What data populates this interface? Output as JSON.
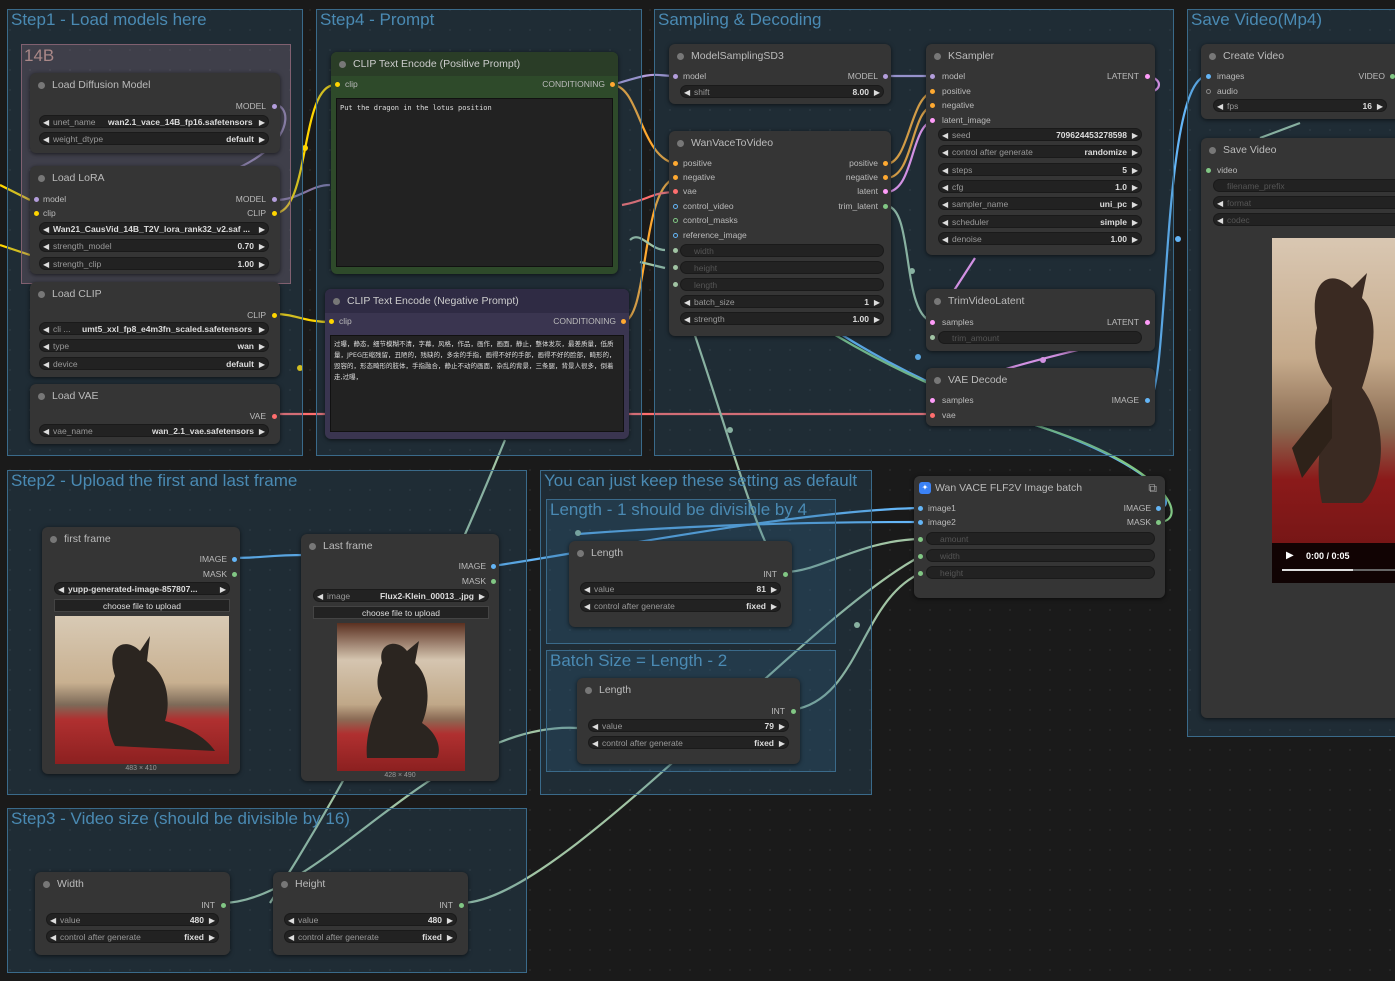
{
  "groups": {
    "step1": "Step1 - Load models here",
    "step4": "Step4 - Prompt",
    "sampling": "Sampling & Decoding",
    "save": "Save Video(Mp4)",
    "step2": "Step2 - Upload the first and last frame",
    "defaults": "You can just keep these setting as default",
    "length_div": "Length - 1 should be divisible by 4",
    "batch": "Batch Size = Length - 2",
    "step3": "Step3 - Video size (should be divisible by 16)",
    "sub14b": "14B"
  },
  "load_diffusion": {
    "title": "Load Diffusion Model",
    "out": "MODEL",
    "unet_label": "unet_name",
    "unet_value": "wan2.1_vace_14B_fp16.safetensors",
    "dtype_label": "weight_dtype",
    "dtype_value": "default"
  },
  "load_lora": {
    "title": "Load LoRA",
    "in_model": "model",
    "in_clip": "clip",
    "out_model": "MODEL",
    "out_clip": "CLIP",
    "lora_name": "Wan21_CausVid_14B_T2V_lora_rank32_v2.saf ...",
    "strength_model_label": "strength_model",
    "strength_model_value": "0.70",
    "strength_clip_label": "strength_clip",
    "strength_clip_value": "1.00"
  },
  "load_clip": {
    "title": "Load CLIP",
    "out": "CLIP",
    "name_label": "cli ...",
    "name_value": "umt5_xxl_fp8_e4m3fn_scaled.safetensors",
    "type_label": "type",
    "type_value": "wan",
    "device_label": "device",
    "device_value": "default"
  },
  "load_vae": {
    "title": "Load VAE",
    "out": "VAE",
    "name_label": "vae_name",
    "name_value": "wan_2.1_vae.safetensors"
  },
  "pos_prompt": {
    "title": "CLIP Text Encode (Positive Prompt)",
    "in": "clip",
    "out": "CONDITIONING",
    "text": "Put the dragon in the lotus position"
  },
  "neg_prompt": {
    "title": "CLIP Text Encode (Negative Prompt)",
    "in": "clip",
    "out": "CONDITIONING",
    "text": "过曝，静态，细节模糊不清，字幕，风格，作品，画作，画面，静止，整体发灰，最差质量，低质量，JPEG压缩残留，丑陋的，残缺的，多余的手指，画得不好的手部，画得不好的脸部，畸形的，毁容的，形态畸形的肢体，手指融合，静止不动的画面，杂乱的背景，三条腿，背景人很多，倒着走,过曝，"
  },
  "model_sampling": {
    "title": "ModelSamplingSD3",
    "in": "model",
    "out": "MODEL",
    "shift_label": "shift",
    "shift_value": "8.00"
  },
  "wan_vace": {
    "title": "WanVaceToVideo",
    "in_positive": "positive",
    "in_negative": "negative",
    "in_vae": "vae",
    "in_control_video": "control_video",
    "in_control_masks": "control_masks",
    "in_reference_image": "reference_image",
    "out_positive": "positive",
    "out_negative": "negative",
    "out_latent": "latent",
    "out_trim": "trim_latent",
    "w_width": "width",
    "w_height": "height",
    "w_length": "length",
    "batch_label": "batch_size",
    "batch_value": "1",
    "strength_label": "strength",
    "strength_value": "1.00"
  },
  "ksampler": {
    "title": "KSampler",
    "in_model": "model",
    "in_positive": "positive",
    "in_negative": "negative",
    "in_latent": "latent_image",
    "out": "LATENT",
    "seed_label": "seed",
    "seed_value": "709624453278598",
    "cag_label": "control after generate",
    "cag_value": "randomize",
    "steps_label": "steps",
    "steps_value": "5",
    "cfg_label": "cfg",
    "cfg_value": "1.0",
    "sampler_label": "sampler_name",
    "sampler_value": "uni_pc",
    "scheduler_label": "scheduler",
    "scheduler_value": "simple",
    "denoise_label": "denoise",
    "denoise_value": "1.00"
  },
  "trim": {
    "title": "TrimVideoLatent",
    "in": "samples",
    "out": "LATENT",
    "w_trim": "trim_amount"
  },
  "vae_decode": {
    "title": "VAE Decode",
    "in_samples": "samples",
    "in_vae": "vae",
    "out": "IMAGE"
  },
  "create_video": {
    "title": "Create Video",
    "in_images": "images",
    "in_audio": "audio",
    "out": "VIDEO",
    "fps_label": "fps",
    "fps_value": "16"
  },
  "save_video": {
    "title": "Save Video",
    "in_video": "video",
    "w_prefix": "filename_prefix",
    "w_format": "format",
    "w_codec": "codec",
    "time": "0:00 / 0:05"
  },
  "first_frame": {
    "title": "first frame",
    "out_image": "IMAGE",
    "out_mask": "MASK",
    "image_value": "yupp-generated-image-857807...",
    "upload": "choose file to upload",
    "dims": "483 × 410"
  },
  "last_frame": {
    "title": "Last frame",
    "out_image": "IMAGE",
    "out_mask": "MASK",
    "image_label": "image",
    "image_value": "Flux2-Klein_00013_.jpg",
    "upload": "choose file to upload",
    "dims": "428 × 490"
  },
  "length1": {
    "title": "Length",
    "out": "INT",
    "value_label": "value",
    "value": "81",
    "cag_label": "control after generate",
    "cag_value": "fixed"
  },
  "length2": {
    "title": "Length",
    "out": "INT",
    "value_label": "value",
    "value": "79",
    "cag_label": "control after generate",
    "cag_value": "fixed"
  },
  "wan_batch": {
    "title": "Wan VACE  FLF2V Image batch",
    "in_image1": "image1",
    "in_image2": "image2",
    "out_image": "IMAGE",
    "out_mask": "MASK",
    "w_amount": "amount",
    "w_width": "width",
    "w_height": "height"
  },
  "width_node": {
    "title": "Width",
    "out": "INT",
    "value_label": "value",
    "value": "480",
    "cag_label": "control after generate",
    "cag_value": "fixed"
  },
  "height_node": {
    "title": "Height",
    "out": "INT",
    "value_label": "value",
    "value": "480",
    "cag_label": "control after generate",
    "cag_value": "fixed"
  },
  "colors": {
    "model": "#b39ddb",
    "clip": "#ffd500",
    "vae": "#ff6e6e",
    "cond": "#ffa931",
    "latent": "#ff9cf9",
    "image": "#64b5f6",
    "mask": "#81c784",
    "int": "#a1c4a4"
  }
}
